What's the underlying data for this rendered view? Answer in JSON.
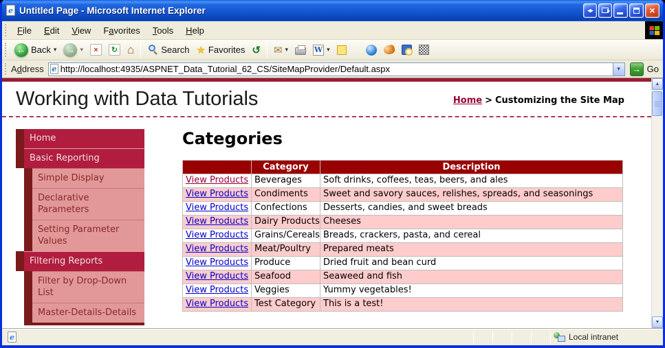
{
  "window": {
    "title": "Untitled Page - Microsoft Internet Explorer"
  },
  "icons": {
    "ie_logo": "e",
    "titlebar_arrows": "◂▸",
    "close": "×",
    "back_arrow": "←",
    "forward_arrow": "→",
    "stop_x": "×",
    "refresh": "↻",
    "home": "⌂",
    "favorites_star": "★",
    "history": "↺",
    "mail": "✉",
    "word": "W",
    "dropdown": "▾",
    "go_arrow": "→",
    "scroll_up": "▲",
    "scroll_down": "▼"
  },
  "menu_bar": {
    "items": [
      {
        "pre": "",
        "key": "F",
        "post": "ile"
      },
      {
        "pre": "",
        "key": "E",
        "post": "dit"
      },
      {
        "pre": "",
        "key": "V",
        "post": "iew"
      },
      {
        "pre": "F",
        "key": "a",
        "post": "vorites"
      },
      {
        "pre": "",
        "key": "T",
        "post": "ools"
      },
      {
        "pre": "",
        "key": "H",
        "post": "elp"
      }
    ]
  },
  "toolbar": {
    "back_label": "Back",
    "search_label": "Search",
    "favorites_label": "Favorites"
  },
  "address_bar": {
    "label": {
      "pre": "A",
      "key": "d",
      "post": "dress"
    },
    "url": "http://localhost:4935/ASPNET_Data_Tutorial_62_CS/SiteMapProvider/Default.aspx",
    "go_label": "Go"
  },
  "page": {
    "site_title": "Working with Data Tutorials",
    "breadcrumb": {
      "home": "Home",
      "separator": ">",
      "current": "Customizing the Site Map"
    },
    "sidebar": {
      "items": [
        {
          "label": "Home",
          "level": 1
        },
        {
          "label": "Basic Reporting",
          "level": 1
        },
        {
          "label": "Simple Display",
          "level": 2
        },
        {
          "label": "Declarative Parameters",
          "level": 2
        },
        {
          "label": "Setting Parameter Values",
          "level": 2
        },
        {
          "label": "Filtering Reports",
          "level": 1
        },
        {
          "label": "Filter by Drop-Down List",
          "level": 2
        },
        {
          "label": "Master-Details-Details",
          "level": 2
        }
      ]
    },
    "main": {
      "heading": "Categories",
      "table": {
        "headers": [
          "",
          "Category",
          "Description"
        ],
        "link_label": "View Products",
        "rows": [
          {
            "category": "Beverages",
            "description": "Soft drinks, coffees, teas, beers, and ales",
            "visited": true
          },
          {
            "category": "Condiments",
            "description": "Sweet and savory sauces, relishes, spreads, and seasonings",
            "visited": false
          },
          {
            "category": "Confections",
            "description": "Desserts, candies, and sweet breads",
            "visited": false
          },
          {
            "category": "Dairy Products",
            "description": "Cheeses",
            "visited": false
          },
          {
            "category": "Grains/Cereals",
            "description": "Breads, crackers, pasta, and cereal",
            "visited": false
          },
          {
            "category": "Meat/Poultry",
            "description": "Prepared meats",
            "visited": false
          },
          {
            "category": "Produce",
            "description": "Dried fruit and bean curd",
            "visited": false
          },
          {
            "category": "Seafood",
            "description": "Seaweed and fish",
            "visited": false
          },
          {
            "category": "Veggies",
            "description": "Yummy vegetables!",
            "visited": false
          },
          {
            "category": "Test Category",
            "description": "This is a test!",
            "visited": false
          }
        ]
      }
    }
  },
  "status_bar": {
    "security_zone": "Local intranet"
  },
  "colors": {
    "xp_title_blue": "#1557d2",
    "window_border": "#0831d9",
    "chrome_beige": "#ece9d8",
    "page_accent_crimson": "#b01d3e",
    "nav_block_maroon": "#7a1a1a",
    "nav_sub_pink": "#e29898",
    "table_header_red": "#990000",
    "row_alt_pink": "#ffcccc",
    "link_blue": "#0000cc",
    "visited_link_maroon": "#990033"
  }
}
